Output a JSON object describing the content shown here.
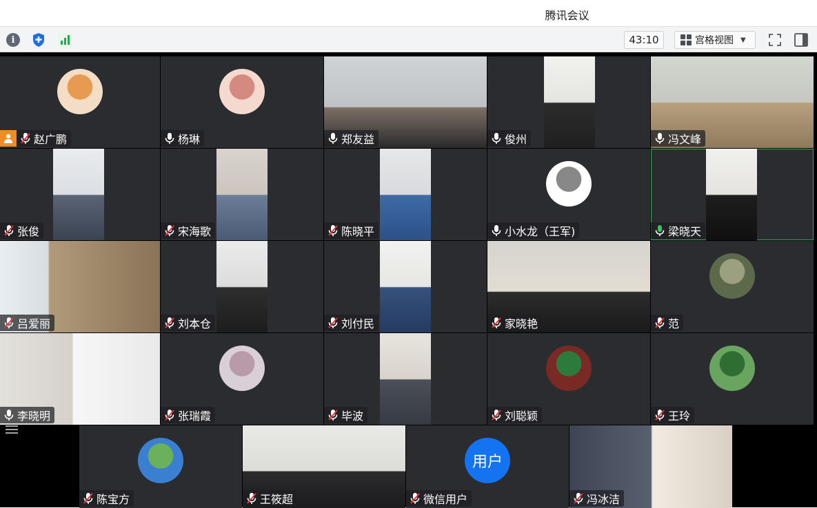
{
  "window": {
    "title": "腾讯会议"
  },
  "toolbar": {
    "timer": "43:10",
    "view_mode": "宫格视图",
    "icons": [
      "info-icon",
      "shield-icon",
      "signal-icon",
      "fullscreen-icon",
      "sidebar-icon"
    ]
  },
  "colors": {
    "accent_green": "#2fb35a",
    "host_orange": "#f28c28",
    "user_blue": "#1473f0",
    "stage_bg": "#000000",
    "tile_bg": "#2b2c30"
  },
  "participants": [
    {
      "name": "赵广鹏",
      "mic": "muted",
      "host": true
    },
    {
      "name": "杨琳",
      "mic": "on"
    },
    {
      "name": "郑友益",
      "mic": "on"
    },
    {
      "name": "俊州",
      "mic": "on"
    },
    {
      "name": "冯文峰",
      "mic": "on"
    },
    {
      "name": "张俊",
      "mic": "muted"
    },
    {
      "name": "宋海歌",
      "mic": "muted"
    },
    {
      "name": "陈晓平",
      "mic": "muted"
    },
    {
      "name": "小水龙（王军)",
      "mic": "on"
    },
    {
      "name": "梁晓天",
      "mic": "speaking"
    },
    {
      "name": "吕爱丽",
      "mic": "muted"
    },
    {
      "name": "刘本仓",
      "mic": "muted"
    },
    {
      "name": "刘付民",
      "mic": "muted"
    },
    {
      "name": "家晓艳",
      "mic": "muted"
    },
    {
      "name": "范",
      "mic": "muted"
    },
    {
      "name": "李晓明",
      "mic": "on"
    },
    {
      "name": "张瑞霞",
      "mic": "muted"
    },
    {
      "name": "毕波",
      "mic": "muted"
    },
    {
      "name": "刘聪颖",
      "mic": "muted"
    },
    {
      "name": "王玲",
      "mic": "muted"
    },
    {
      "name": "陈宝方",
      "mic": "muted"
    },
    {
      "name": "王筱超",
      "mic": "muted"
    },
    {
      "name": "微信用户",
      "mic": "muted"
    },
    {
      "name": "冯冰洁",
      "mic": "muted"
    }
  ],
  "user_avatar_text": "用户"
}
